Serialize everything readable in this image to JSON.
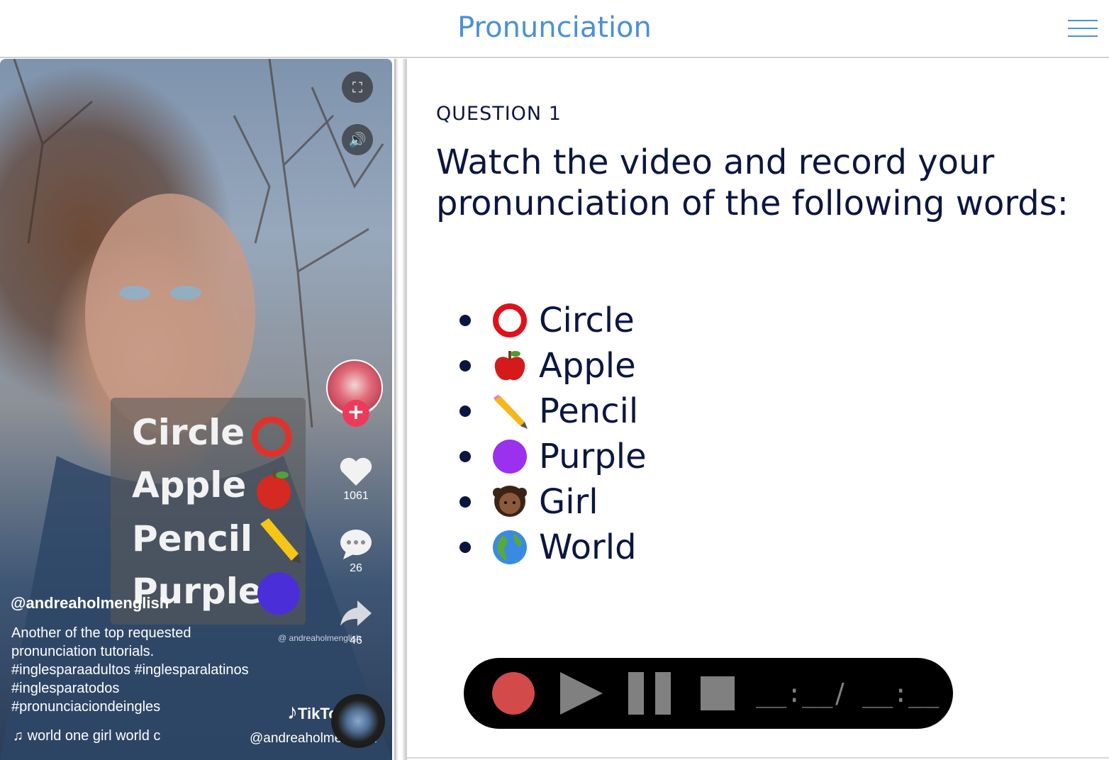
{
  "header": {
    "title": "Pronunciation",
    "menu_icon": "hamburger-menu-icon"
  },
  "video": {
    "controls": {
      "fullscreen_icon": "fullscreen-icon",
      "volume_icon": "volume-icon"
    },
    "card_words": [
      "Circle",
      "Apple",
      "Pencil",
      "Purple"
    ],
    "likes": "1061",
    "comments": "26",
    "shares": "46",
    "username": "@andreaholmenglish",
    "watermark_handle": "@ andreaholmenglish",
    "caption_lines": [
      "Another of the top requested",
      "pronunciation tutorials.",
      "#inglesparaadultos #inglesparalatinos",
      "#inglesparatodos",
      "#pronunciaciondeingles"
    ],
    "music": "world   one girl world   c",
    "tiktok_brand": "TikTok",
    "handle_bottom": "@andreaholmenglish"
  },
  "question": {
    "label": "QUESTION 1",
    "prompt": "Watch the video and record your pronunciation of the following words:",
    "words": [
      {
        "emoji": "red-circle-icon",
        "text": "Circle"
      },
      {
        "emoji": "apple-icon",
        "text": "Apple"
      },
      {
        "emoji": "pencil-icon",
        "text": "Pencil"
      },
      {
        "emoji": "purple-circle-icon",
        "text": "Purple"
      },
      {
        "emoji": "girl-icon",
        "text": "Girl"
      },
      {
        "emoji": "globe-icon",
        "text": "World"
      }
    ]
  },
  "recorder": {
    "current_time": "__:__",
    "separator": "/",
    "total_time": "__:__"
  },
  "colors": {
    "header_title": "#4a90d9",
    "text": "#0b1640",
    "record": "#d24a4a",
    "recorder_bg": "#000000",
    "recorder_controls": "#808080"
  }
}
